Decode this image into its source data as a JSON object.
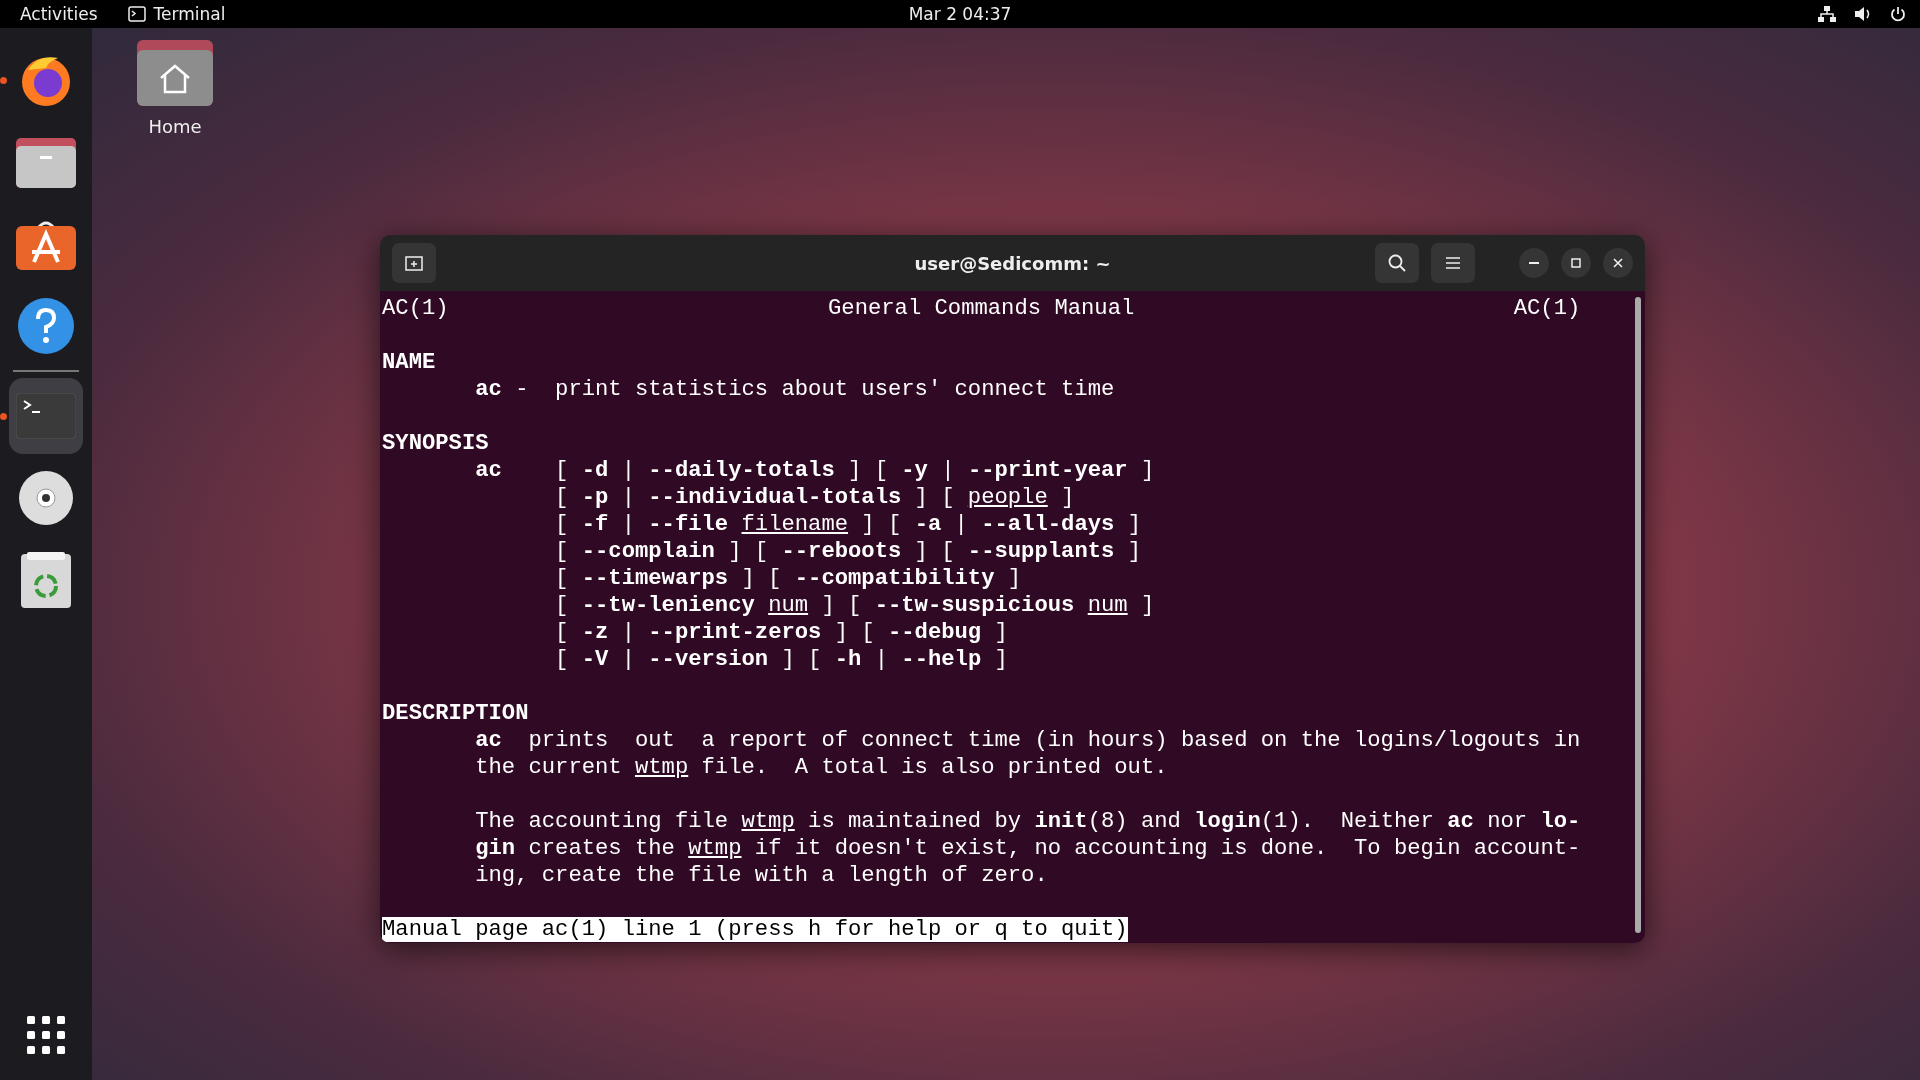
{
  "top_bar": {
    "activities": "Activities",
    "app_name": "Terminal",
    "clock": "Mar 2  04:37"
  },
  "dock": {
    "items": [
      {
        "kind": "firefox",
        "running": true,
        "selected": false
      },
      {
        "kind": "files",
        "running": false,
        "selected": false
      },
      {
        "kind": "software",
        "running": false,
        "selected": false
      },
      {
        "kind": "help",
        "running": false,
        "selected": false
      },
      {
        "kind": "terminal",
        "running": true,
        "selected": true
      },
      {
        "kind": "disc",
        "running": false,
        "selected": false
      },
      {
        "kind": "trash",
        "running": false,
        "selected": false
      }
    ]
  },
  "desktop_icons": [
    {
      "label": "Home"
    }
  ],
  "window": {
    "title": "user@Sedicomm: ~",
    "man_page": {
      "header": {
        "left": "AC(1)",
        "center": "General Commands Manual",
        "right": "AC(1)"
      },
      "sections": [
        {
          "heading": "NAME",
          "kind": "text",
          "paragraphs": [
            [
              "**ac** -  print statistics about users' connect time"
            ]
          ]
        },
        {
          "heading": "SYNOPSIS",
          "kind": "synopsis",
          "command": "ac",
          "lines": [
            "[ **-d** | **--daily-totals** ] [ **-y** | **--print-year** ]",
            "[ **-p** | **--individual-totals** ] [ *people* ]",
            "[ **-f** | **--file** *filename* ] [ **-a** | **--all-days** ]",
            "[ **--complain** ] [ **--reboots** ] [ **--supplants** ]",
            "[ **--timewarps** ] [ **--compatibility** ]",
            "[ **--tw-leniency** *num* ] [ **--tw-suspicious** *num* ]",
            "[ **-z** | **--print-zeros** ] [ **--debug** ]",
            "[ **-V** | **--version** ] [ **-h** | **--help** ]"
          ]
        },
        {
          "heading": "DESCRIPTION",
          "kind": "text",
          "paragraphs": [
            [
              "**ac**  prints  out  a report of connect time (in hours) based on the logins/logouts in",
              "the current *wtmp* file.  A total is also printed out."
            ],
            [
              "The accounting file *wtmp* is maintained by **init**(8) and **login**(1).  Neither **ac** nor **lo-**",
              "**gin** creates the *wtmp* if it doesn't exist, no accounting is done.  To begin account-",
              "ing, create the file with a length of zero."
            ]
          ]
        }
      ],
      "status_line": "Manual page ac(1) line 1 (press h for help or q to quit)"
    }
  }
}
